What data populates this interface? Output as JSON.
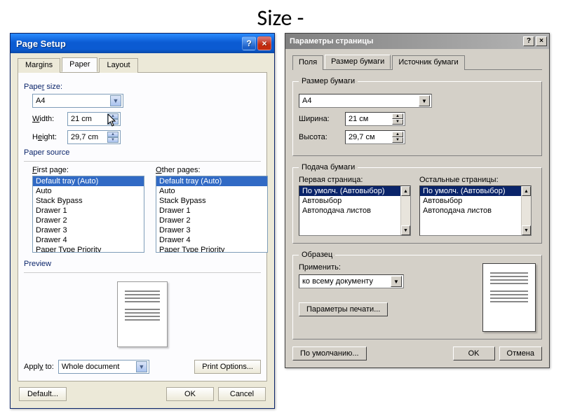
{
  "pageTitle": "Size -",
  "left": {
    "window_title": "Page Setup",
    "tabs": {
      "margins": "Margins",
      "paper": "Paper",
      "layout": "Layout"
    },
    "paper_size_label": "Paper size:",
    "paper_size_value": "A4",
    "width_label": "Width:",
    "width_value": "21 cm",
    "height_label": "Height:",
    "height_value": "29,7 cm",
    "paper_source_label": "Paper source",
    "first_page_label": "First page:",
    "other_pages_label": "Other pages:",
    "tray_items": [
      "Default tray (Auto)",
      "Auto",
      "Stack Bypass",
      "Drawer 1",
      "Drawer 2",
      "Drawer 3",
      "Drawer 4",
      "Paper Type Priority"
    ],
    "preview_label": "Preview",
    "apply_to_label": "Apply to:",
    "apply_to_value": "Whole document",
    "print_options_btn": "Print Options...",
    "default_btn": "Default...",
    "ok_btn": "OK",
    "cancel_btn": "Cancel"
  },
  "right": {
    "window_title": "Параметры страницы",
    "tabs": {
      "polya": "Поля",
      "razmer": "Размер бумаги",
      "istochnik": "Источник бумаги"
    },
    "paper_size_group": "Размер бумаги",
    "paper_size_value": "A4",
    "width_label": "Ширина:",
    "width_value": "21 см",
    "height_label": "Высота:",
    "height_value": "29,7 см",
    "paper_source_group": "Подача бумаги",
    "first_page_label": "Первая страница:",
    "other_pages_label": "Остальные страницы:",
    "tray_items": [
      "По умолч. (Автовыбор)",
      "Автовыбор",
      "Автоподача листов"
    ],
    "sample_group": "Образец",
    "apply_label": "Применить:",
    "apply_value": "ко всему документу",
    "print_params_btn": "Параметры печати...",
    "default_btn": "По умолчанию...",
    "ok_btn": "OK",
    "cancel_btn": "Отмена"
  }
}
